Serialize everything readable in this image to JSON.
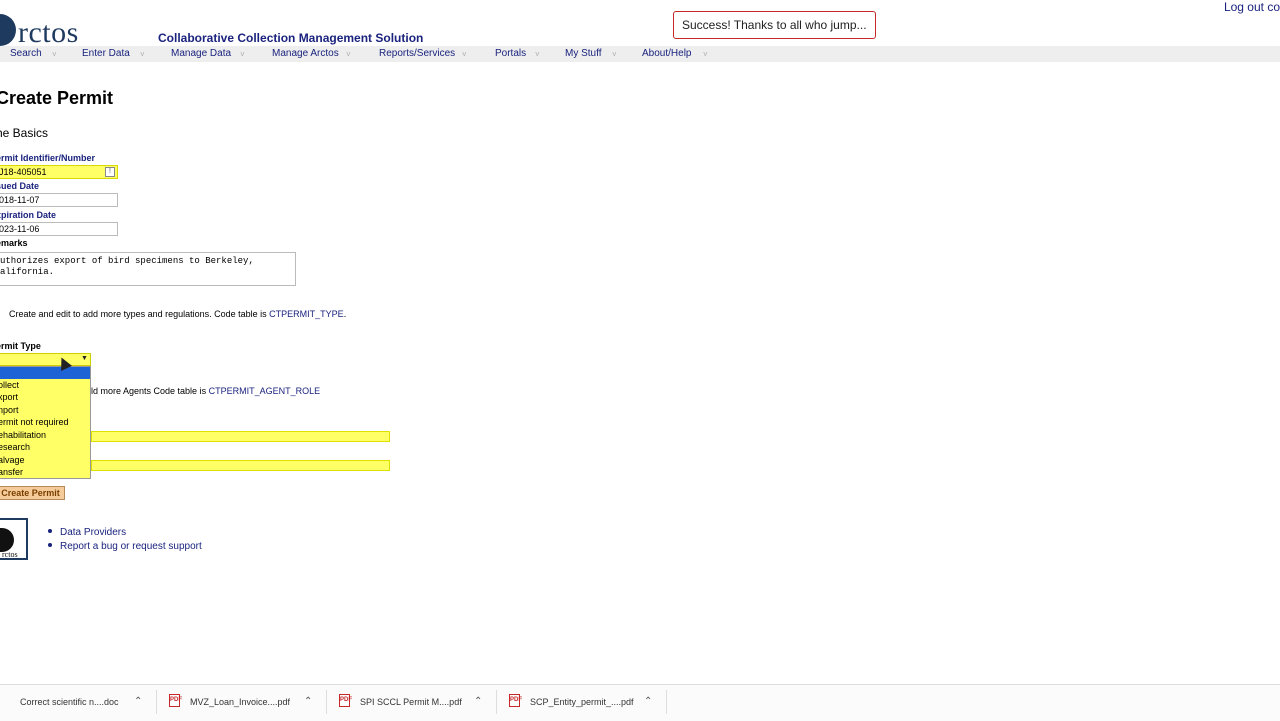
{
  "header": {
    "logo_text": "rctos",
    "app_title": "Collaborative Collection Management Solution",
    "toast": "Success! Thanks to all who jump...",
    "logout": "Log out co"
  },
  "nav": [
    {
      "label": "Search"
    },
    {
      "label": "Enter Data"
    },
    {
      "label": "Manage Data"
    },
    {
      "label": "Manage Arctos"
    },
    {
      "label": "Reports/Services"
    },
    {
      "label": "Portals"
    },
    {
      "label": "My Stuff"
    },
    {
      "label": "About/Help"
    }
  ],
  "page": {
    "title": "Create Permit",
    "section": "he Basics"
  },
  "fields": {
    "permit_id_label": "ermit Identifier/Number",
    "permit_id_value": "J18-405051",
    "issued_label": "sued Date",
    "issued_value": "018-11-07",
    "expiration_label": "xpiration Date",
    "expiration_value": "023-11-06",
    "remarks_label": "emarks",
    "remarks_value": "uthorizes export of bird specimens to Berkeley,\nalifornia."
  },
  "types_info": {
    "text": "Create and edit to add more types and regulations. Code table is ",
    "link": "CTPERMIT_TYPE",
    "suffix": "."
  },
  "permit_type": {
    "label": "ermit Type",
    "selected": "",
    "options": [
      "",
      "ollect",
      "xport",
      "nport",
      "ermit not required",
      "ehabilitation",
      "esearch",
      "alvage",
      "ansfer"
    ]
  },
  "agents_info": {
    "text": "ld more Agents Code table is ",
    "link": "CTPERMIT_AGENT_ROLE"
  },
  "create_button": "Create Permit",
  "footer": {
    "logo_text": "rctos",
    "links": [
      "Data Providers",
      "Report a bug or request support"
    ]
  },
  "downloads": [
    {
      "name": "Correct scientific n....doc",
      "type": "doc"
    },
    {
      "name": "MVZ_Loan_Invoice....pdf",
      "type": "pdf"
    },
    {
      "name": "SPI SCCL Permit M....pdf",
      "type": "pdf"
    },
    {
      "name": "SCP_Entity_permit_....pdf",
      "type": "pdf"
    }
  ],
  "colors": {
    "highlight": "#ffff66",
    "nav_text": "#1a237e",
    "selected_option": "#1e63d6",
    "button_bg": "#f5cc99"
  }
}
